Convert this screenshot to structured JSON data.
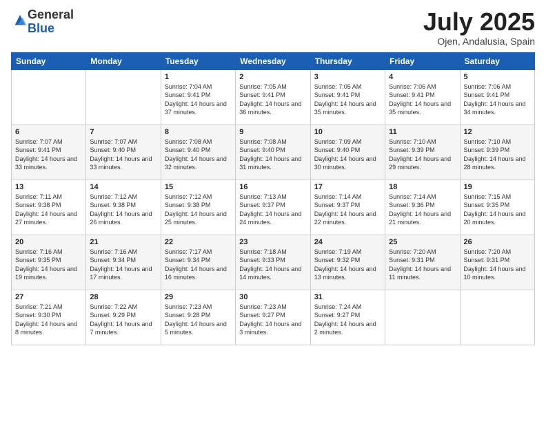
{
  "header": {
    "logo_general": "General",
    "logo_blue": "Blue",
    "month_title": "July 2025",
    "location": "Ojen, Andalusia, Spain"
  },
  "weekdays": [
    "Sunday",
    "Monday",
    "Tuesday",
    "Wednesday",
    "Thursday",
    "Friday",
    "Saturday"
  ],
  "weeks": [
    [
      {
        "day": "",
        "info": ""
      },
      {
        "day": "",
        "info": ""
      },
      {
        "day": "1",
        "info": "Sunrise: 7:04 AM\nSunset: 9:41 PM\nDaylight: 14 hours and 37 minutes."
      },
      {
        "day": "2",
        "info": "Sunrise: 7:05 AM\nSunset: 9:41 PM\nDaylight: 14 hours and 36 minutes."
      },
      {
        "day": "3",
        "info": "Sunrise: 7:05 AM\nSunset: 9:41 PM\nDaylight: 14 hours and 35 minutes."
      },
      {
        "day": "4",
        "info": "Sunrise: 7:06 AM\nSunset: 9:41 PM\nDaylight: 14 hours and 35 minutes."
      },
      {
        "day": "5",
        "info": "Sunrise: 7:06 AM\nSunset: 9:41 PM\nDaylight: 14 hours and 34 minutes."
      }
    ],
    [
      {
        "day": "6",
        "info": "Sunrise: 7:07 AM\nSunset: 9:41 PM\nDaylight: 14 hours and 33 minutes."
      },
      {
        "day": "7",
        "info": "Sunrise: 7:07 AM\nSunset: 9:40 PM\nDaylight: 14 hours and 33 minutes."
      },
      {
        "day": "8",
        "info": "Sunrise: 7:08 AM\nSunset: 9:40 PM\nDaylight: 14 hours and 32 minutes."
      },
      {
        "day": "9",
        "info": "Sunrise: 7:08 AM\nSunset: 9:40 PM\nDaylight: 14 hours and 31 minutes."
      },
      {
        "day": "10",
        "info": "Sunrise: 7:09 AM\nSunset: 9:40 PM\nDaylight: 14 hours and 30 minutes."
      },
      {
        "day": "11",
        "info": "Sunrise: 7:10 AM\nSunset: 9:39 PM\nDaylight: 14 hours and 29 minutes."
      },
      {
        "day": "12",
        "info": "Sunrise: 7:10 AM\nSunset: 9:39 PM\nDaylight: 14 hours and 28 minutes."
      }
    ],
    [
      {
        "day": "13",
        "info": "Sunrise: 7:11 AM\nSunset: 9:38 PM\nDaylight: 14 hours and 27 minutes."
      },
      {
        "day": "14",
        "info": "Sunrise: 7:12 AM\nSunset: 9:38 PM\nDaylight: 14 hours and 26 minutes."
      },
      {
        "day": "15",
        "info": "Sunrise: 7:12 AM\nSunset: 9:38 PM\nDaylight: 14 hours and 25 minutes."
      },
      {
        "day": "16",
        "info": "Sunrise: 7:13 AM\nSunset: 9:37 PM\nDaylight: 14 hours and 24 minutes."
      },
      {
        "day": "17",
        "info": "Sunrise: 7:14 AM\nSunset: 9:37 PM\nDaylight: 14 hours and 22 minutes."
      },
      {
        "day": "18",
        "info": "Sunrise: 7:14 AM\nSunset: 9:36 PM\nDaylight: 14 hours and 21 minutes."
      },
      {
        "day": "19",
        "info": "Sunrise: 7:15 AM\nSunset: 9:35 PM\nDaylight: 14 hours and 20 minutes."
      }
    ],
    [
      {
        "day": "20",
        "info": "Sunrise: 7:16 AM\nSunset: 9:35 PM\nDaylight: 14 hours and 19 minutes."
      },
      {
        "day": "21",
        "info": "Sunrise: 7:16 AM\nSunset: 9:34 PM\nDaylight: 14 hours and 17 minutes."
      },
      {
        "day": "22",
        "info": "Sunrise: 7:17 AM\nSunset: 9:34 PM\nDaylight: 14 hours and 16 minutes."
      },
      {
        "day": "23",
        "info": "Sunrise: 7:18 AM\nSunset: 9:33 PM\nDaylight: 14 hours and 14 minutes."
      },
      {
        "day": "24",
        "info": "Sunrise: 7:19 AM\nSunset: 9:32 PM\nDaylight: 14 hours and 13 minutes."
      },
      {
        "day": "25",
        "info": "Sunrise: 7:20 AM\nSunset: 9:31 PM\nDaylight: 14 hours and 11 minutes."
      },
      {
        "day": "26",
        "info": "Sunrise: 7:20 AM\nSunset: 9:31 PM\nDaylight: 14 hours and 10 minutes."
      }
    ],
    [
      {
        "day": "27",
        "info": "Sunrise: 7:21 AM\nSunset: 9:30 PM\nDaylight: 14 hours and 8 minutes."
      },
      {
        "day": "28",
        "info": "Sunrise: 7:22 AM\nSunset: 9:29 PM\nDaylight: 14 hours and 7 minutes."
      },
      {
        "day": "29",
        "info": "Sunrise: 7:23 AM\nSunset: 9:28 PM\nDaylight: 14 hours and 5 minutes."
      },
      {
        "day": "30",
        "info": "Sunrise: 7:23 AM\nSunset: 9:27 PM\nDaylight: 14 hours and 3 minutes."
      },
      {
        "day": "31",
        "info": "Sunrise: 7:24 AM\nSunset: 9:27 PM\nDaylight: 14 hours and 2 minutes."
      },
      {
        "day": "",
        "info": ""
      },
      {
        "day": "",
        "info": ""
      }
    ]
  ]
}
